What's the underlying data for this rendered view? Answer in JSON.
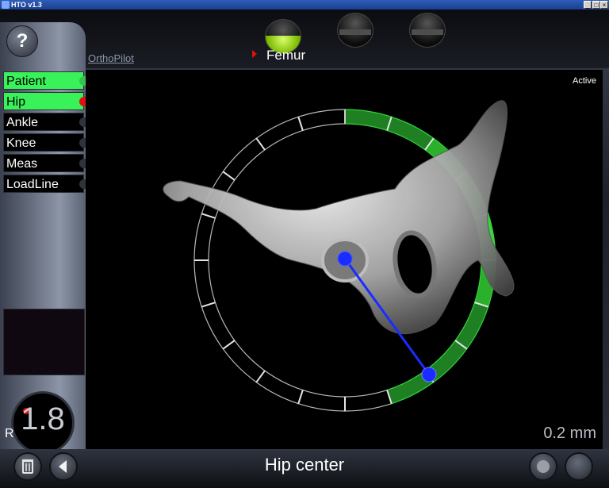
{
  "window": {
    "title": "HTO v1.3",
    "min_glyph": "_",
    "max_glyph": "□",
    "close_glyph": "×"
  },
  "help_button": {
    "label": "?"
  },
  "brand": {
    "label": "OrthoPilot"
  },
  "step_indicator": {
    "current": "Femur",
    "leds": [
      {
        "state": "active"
      },
      {
        "state": "inactive"
      },
      {
        "state": "inactive"
      }
    ]
  },
  "menu": {
    "items": [
      {
        "label": "Patient",
        "state": "on"
      },
      {
        "label": "Hip",
        "state": "on-red"
      },
      {
        "label": "Ankle",
        "state": "off"
      },
      {
        "label": "Knee",
        "state": "off"
      },
      {
        "label": "Meas",
        "state": "off"
      },
      {
        "label": "LoadLine",
        "state": "off"
      }
    ]
  },
  "dial": {
    "value": "1.8",
    "side": "R"
  },
  "viewport": {
    "status": "Active",
    "measurement": "0.2 mm"
  },
  "footer": {
    "status": "Hip center"
  },
  "colors": {
    "accent_green": "#39f25a",
    "ring_green": "#1f9b2a",
    "pointer_blue": "#1a2cff",
    "indicator_red": "#e01010"
  }
}
